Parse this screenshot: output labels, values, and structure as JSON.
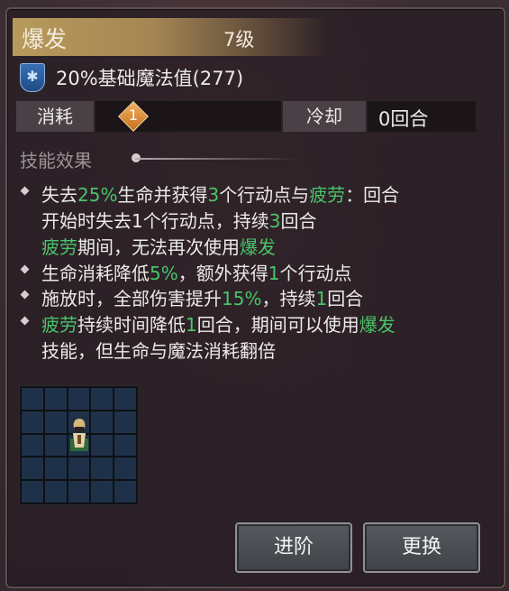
{
  "skill": {
    "name": "爆发",
    "level": "7级"
  },
  "cost": {
    "icon": "snowflake-icon",
    "text": "20%基础魔法值(277)"
  },
  "consume": {
    "label": "消耗",
    "value": "1"
  },
  "cooldown": {
    "label": "冷却",
    "value": "0回合"
  },
  "effects": {
    "title": "技能效果",
    "lines": [
      [
        {
          "t": "失去"
        },
        {
          "t": "25%",
          "hl": true
        },
        {
          "t": "生命并获得"
        },
        {
          "t": "3",
          "hl": true
        },
        {
          "t": "个行动点与"
        },
        {
          "t": "疲劳",
          "hl": true
        },
        {
          "t": "：回合"
        }
      ],
      [
        {
          "t": "开始时失去1个行动点，持续"
        },
        {
          "t": "3",
          "hl": true
        },
        {
          "t": "回合"
        }
      ],
      [
        {
          "t": "疲劳",
          "hl": true
        },
        {
          "t": "期间，无法再次使用"
        },
        {
          "t": "爆发",
          "hl": true
        }
      ],
      [
        {
          "t": "生命消耗降低"
        },
        {
          "t": "5%",
          "hl": true
        },
        {
          "t": "，额外获得"
        },
        {
          "t": "1",
          "hl": true
        },
        {
          "t": "个行动点"
        }
      ],
      [
        {
          "t": "施放时，全部伤害提升"
        },
        {
          "t": "15%",
          "hl": true
        },
        {
          "t": "，持续"
        },
        {
          "t": "1",
          "hl": true
        },
        {
          "t": "回合"
        }
      ],
      [
        {
          "t": "疲劳",
          "hl": true
        },
        {
          "t": "持续时间降低"
        },
        {
          "t": "1",
          "hl": true
        },
        {
          "t": "回合，期间可以使用"
        },
        {
          "t": "爆发",
          "hl": true
        }
      ],
      [
        {
          "t": "技能，但生命与魔法消耗翻倍"
        }
      ]
    ]
  },
  "colors": {
    "highlight": "#49c46a",
    "title_bar": "#b89a5c",
    "grid_cell": "#1e3148"
  },
  "buttons": {
    "advance": "进阶",
    "swap": "更换"
  }
}
